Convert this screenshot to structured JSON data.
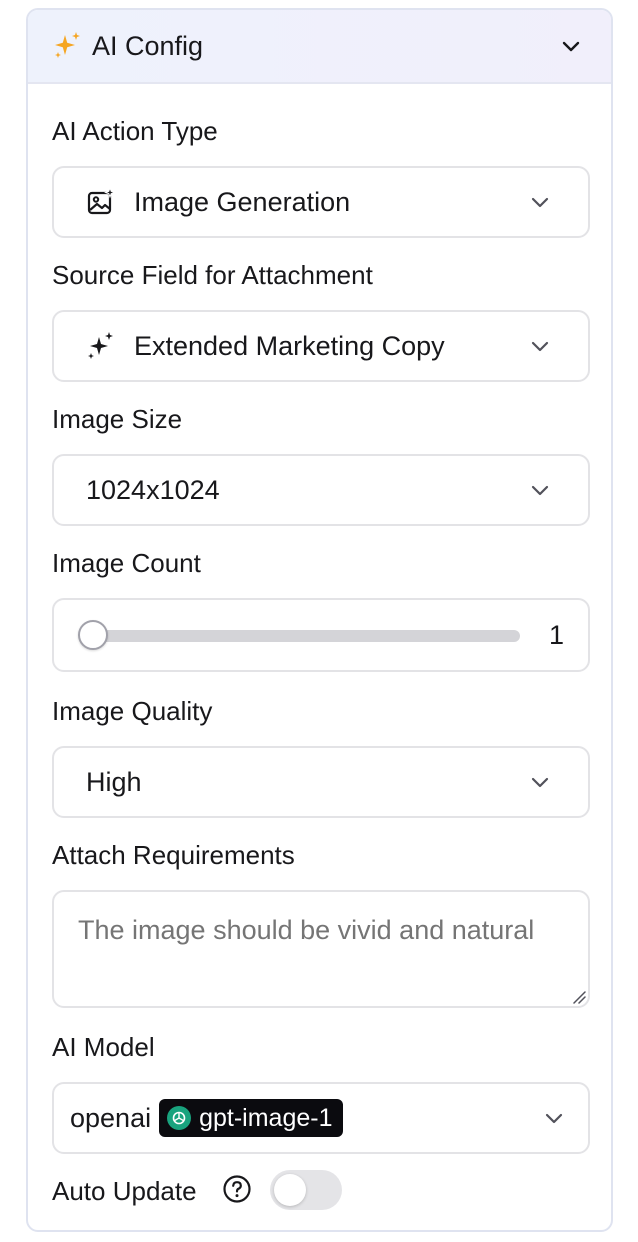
{
  "header": {
    "title": "AI Config",
    "icon": "sparkles-icon",
    "accent": "#f59e0b"
  },
  "action_type": {
    "label": "AI Action Type",
    "value": "Image Generation",
    "icon": "image-sparkle-icon"
  },
  "source_field": {
    "label": "Source Field for Attachment",
    "value": "Extended Marketing Copy",
    "icon": "sparkles-icon"
  },
  "image_size": {
    "label": "Image Size",
    "value": "1024x1024"
  },
  "image_count": {
    "label": "Image Count",
    "value": "1"
  },
  "image_quality": {
    "label": "Image Quality",
    "value": "High"
  },
  "attach_requirements": {
    "label": "Attach Requirements",
    "placeholder": "The image should be vivid and natural"
  },
  "ai_model": {
    "label": "AI Model",
    "provider": "openai",
    "model": "gpt-image-1",
    "badge_color": "#0b0b0f",
    "logo_color": "#19a37e"
  },
  "auto_update": {
    "label": "Auto Update",
    "enabled": false
  }
}
